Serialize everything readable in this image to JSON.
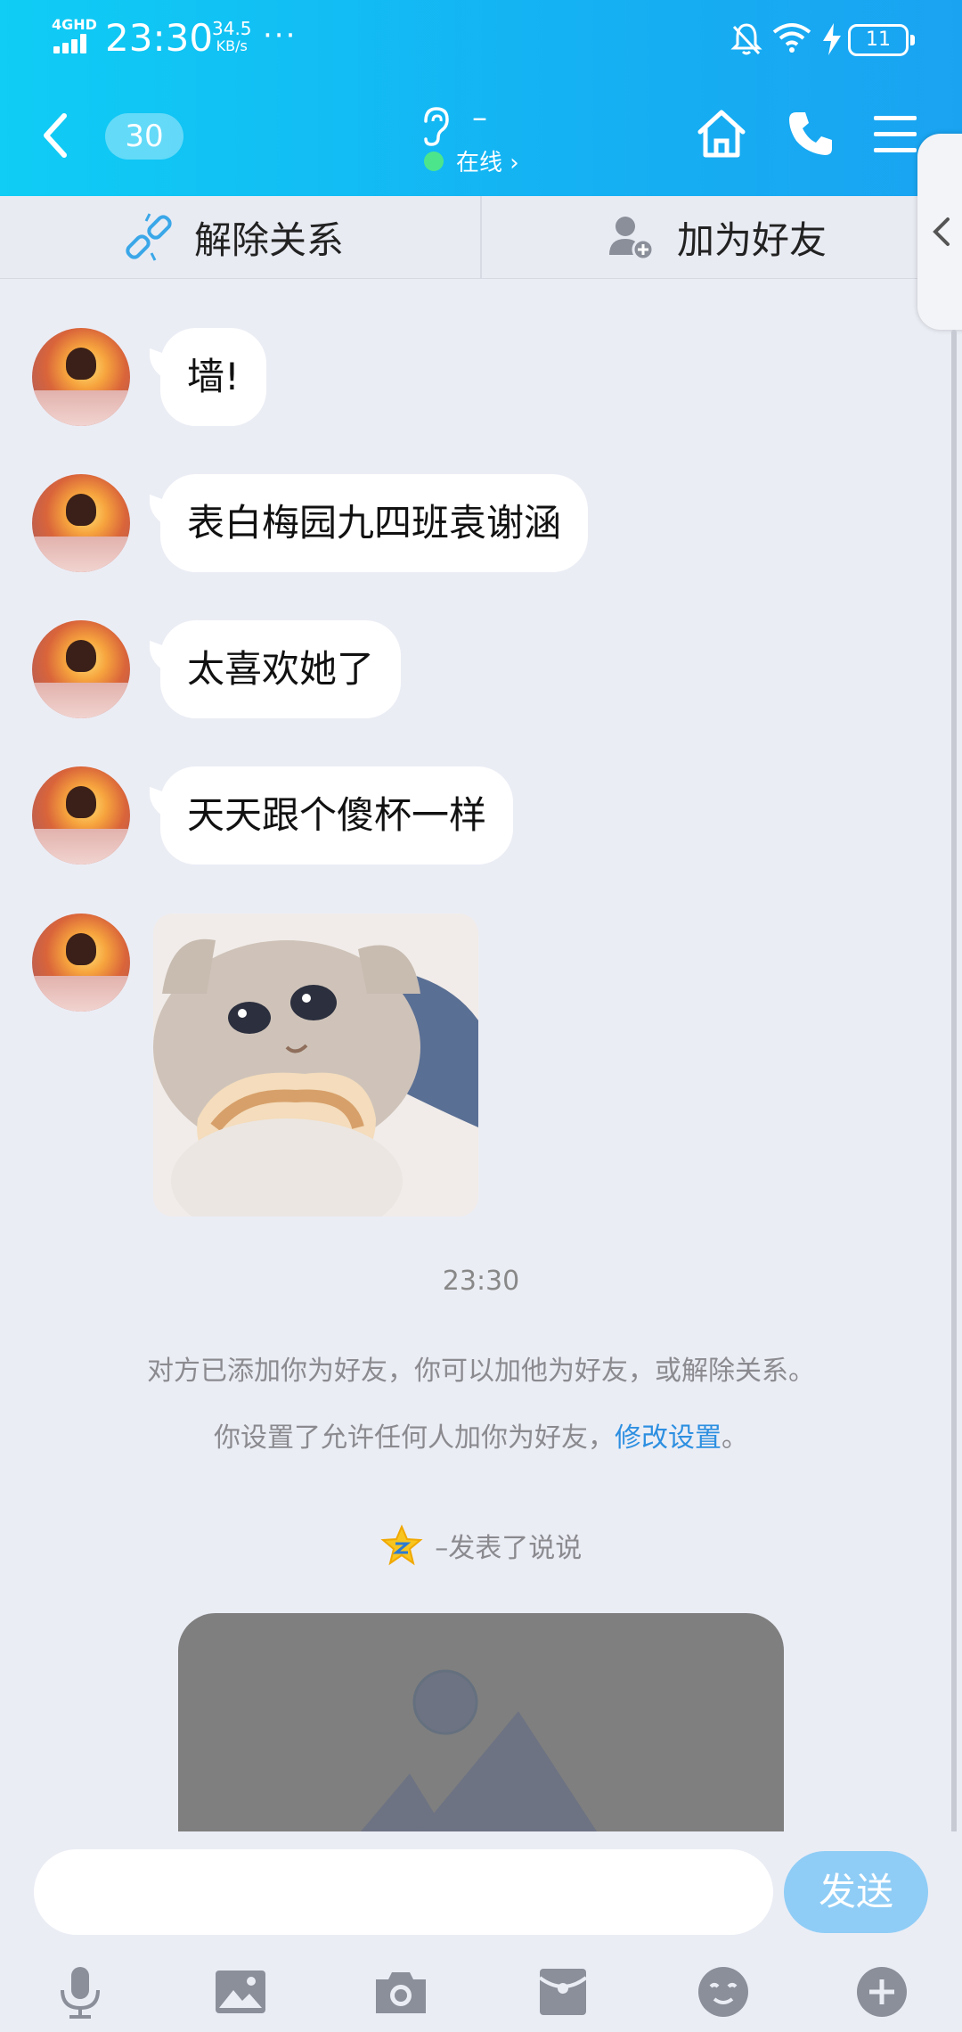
{
  "status_bar": {
    "network": "4GHD",
    "time": "23:30",
    "speed_value": "34.5",
    "speed_unit": "KB/s",
    "more": "···",
    "battery": "11"
  },
  "header": {
    "unread_count": "30",
    "contact_name": "–",
    "status": "在线 ›"
  },
  "action_bar": {
    "remove_relation": "解除关系",
    "add_friend": "加为好友"
  },
  "messages": [
    {
      "text": "墙!"
    },
    {
      "text": "表白梅园九四班袁谢涵"
    },
    {
      "text": "太喜欢她了"
    },
    {
      "text": "天天跟个傻杯一样"
    }
  ],
  "timestamp": "23:30",
  "system_notes": {
    "line1": "对方已添加你为好友，你可以加他为好友，或解除关系。",
    "line2_prefix": "你设置了允许任何人加你为好友，",
    "line2_link": "修改设置",
    "line2_suffix": "。"
  },
  "qzone_post": "–发表了说说",
  "input_bar": {
    "send_label": "发送"
  },
  "colors": {
    "header_start": "#0fcdf5",
    "header_end": "#1aa3f1",
    "send_button": "#8fcdf6",
    "link": "#2d8fe0",
    "online": "#4de58c"
  }
}
